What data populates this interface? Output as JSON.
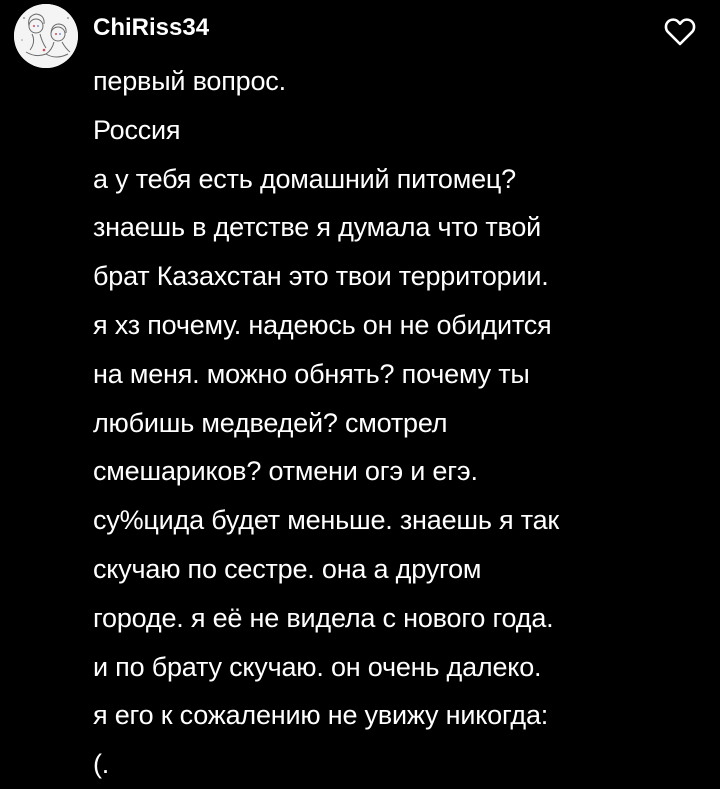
{
  "comment": {
    "username": "ChiRiss34",
    "avatar_icon": "avatar-sketch-icon",
    "like_icon": "heart-outline-icon",
    "text_color": "#ffffff",
    "background": "#000000",
    "lines": [
      "первый вопрос.",
      "Россия",
      "а у тебя есть домашний питомец?",
      "знаешь в детстве я думала что твой",
      "брат Казахстан это твои территории.",
      "я хз почему. надеюсь он не обидится",
      "на меня. можно обнять? почему ты",
      "любишь медведей? смотрел",
      "смешариков?  отмени огэ и егэ.",
      "су%цида будет меньше. знаешь я так",
      "скучаю по сестре. она а другом",
      "городе.  я её не видела с нового года.",
      "и по брату скучаю. он очень далеко.",
      "я его к сожалению не увижу никогда:",
      "(."
    ]
  }
}
